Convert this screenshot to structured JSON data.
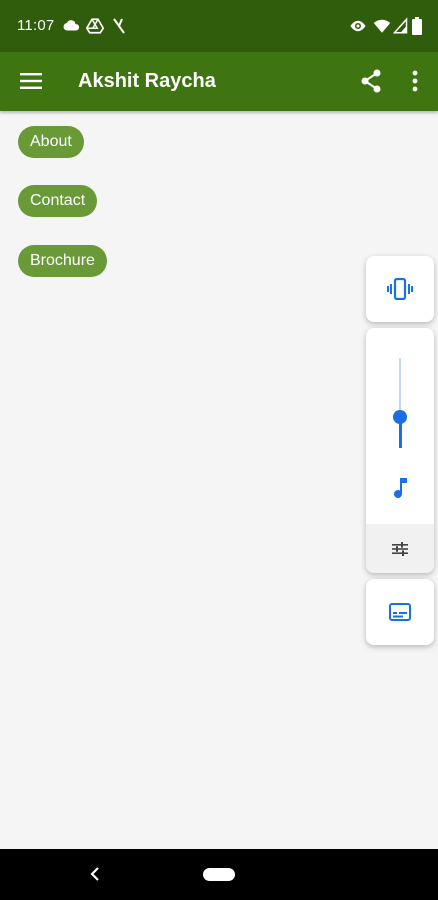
{
  "status_bar": {
    "time": "11:07",
    "icons": [
      "cloud-icon",
      "drive-icon",
      "signal-off-icon",
      "eye-icon",
      "wifi-icon",
      "cellular-icon",
      "battery-icon"
    ]
  },
  "app_bar": {
    "title": "Akshit Raycha",
    "icons": [
      "menu-icon",
      "share-icon",
      "overflow-icon"
    ]
  },
  "main": {
    "chips": [
      {
        "label": "About"
      },
      {
        "label": "Contact"
      },
      {
        "label": "Brochure"
      }
    ]
  },
  "volume_panel": {
    "level_fraction": 0.35,
    "icons": [
      "vibrate-icon",
      "music-note-icon",
      "equalizer-icon",
      "captions-icon"
    ]
  },
  "nav_bar": {
    "icons": [
      "back-icon",
      "home-pill"
    ]
  },
  "colors": {
    "status_bar": "#2f5d0b",
    "app_bar": "#3f7511",
    "chip": "#6a9a37",
    "accent_blue": "#1a6ee6"
  }
}
